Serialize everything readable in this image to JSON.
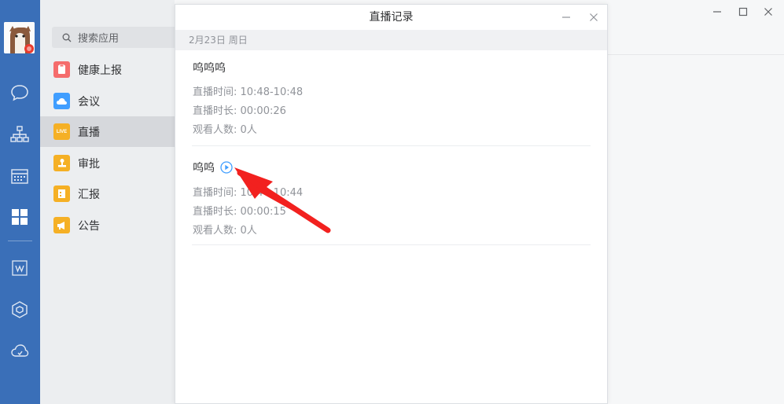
{
  "search": {
    "placeholder": "搜索应用"
  },
  "apps": [
    {
      "label": "健康上报",
      "icon": "health-report-icon",
      "color": "#f56c6c"
    },
    {
      "label": "会议",
      "icon": "meeting-cloud-icon",
      "color": "#409eff"
    },
    {
      "label": "直播",
      "icon": "live-icon",
      "color": "#f5b025",
      "badge": "LIVE"
    },
    {
      "label": "审批",
      "icon": "approval-icon",
      "color": "#f5b025"
    },
    {
      "label": "汇报",
      "icon": "report-icon",
      "color": "#f5b025"
    },
    {
      "label": "公告",
      "icon": "announcement-icon",
      "color": "#f5b025"
    }
  ],
  "dialog": {
    "title": "直播记录",
    "date": "2月23日 周日",
    "records": [
      {
        "title": "呜呜呜",
        "time": "直播时间: 10:48-10:48",
        "duration": "直播时长: 00:00:26",
        "viewers": "观看人数: 0人"
      },
      {
        "title": "呜呜",
        "time": "直播时间: 10:44-10:44",
        "duration": "直播时长: 00:00:15",
        "viewers": "观看人数: 0人"
      }
    ]
  },
  "colors": {
    "rail": "#3a6fb8",
    "accent": "#409eff",
    "arrow": "#f2211f"
  }
}
